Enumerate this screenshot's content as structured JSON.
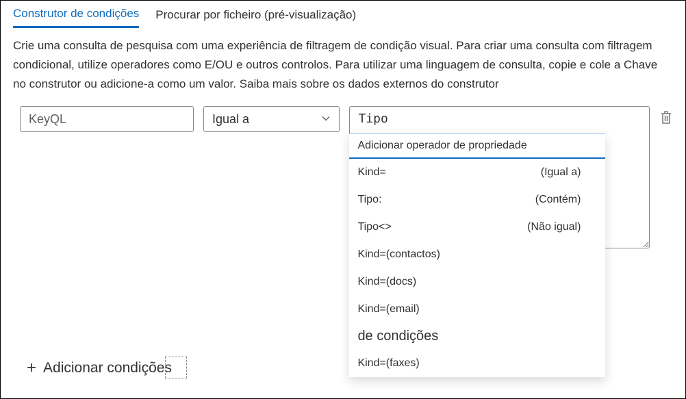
{
  "tabs": {
    "builder": "Construtor de condições",
    "searchfile": "Procurar por ficheiro (pré-visualização)"
  },
  "description": "Crie uma consulta de pesquisa com uma experiência de filtragem de condição visual. Para criar uma consulta com filtragem condicional, utilize operadores como E/OU e outros controlos. Para utilizar uma linguagem de consulta, copie e cole a Chave no construtor ou adicione-a como um valor. Saiba mais sobre os dados externos do construtor",
  "row": {
    "field": "KeyQL",
    "operator": "Igual a",
    "value": "Tipo"
  },
  "dropdown": {
    "header": "Adicionar operador de propriedade",
    "items": [
      {
        "label": "Kind=",
        "hint": "(Igual a)"
      },
      {
        "label": "Tipo:",
        "hint": "(Contém)"
      },
      {
        "label": "Tipo<>",
        "hint": "(Não igual)"
      },
      {
        "label": "Kind=(contactos)",
        "hint": ""
      },
      {
        "label": "Kind=(docs)",
        "hint": ""
      },
      {
        "label": "Kind=(email)",
        "hint": ""
      }
    ],
    "group": "de condições",
    "items2": [
      {
        "label": "Kind=(faxes)",
        "hint": ""
      }
    ]
  },
  "addConditions": "Adicionar condições"
}
